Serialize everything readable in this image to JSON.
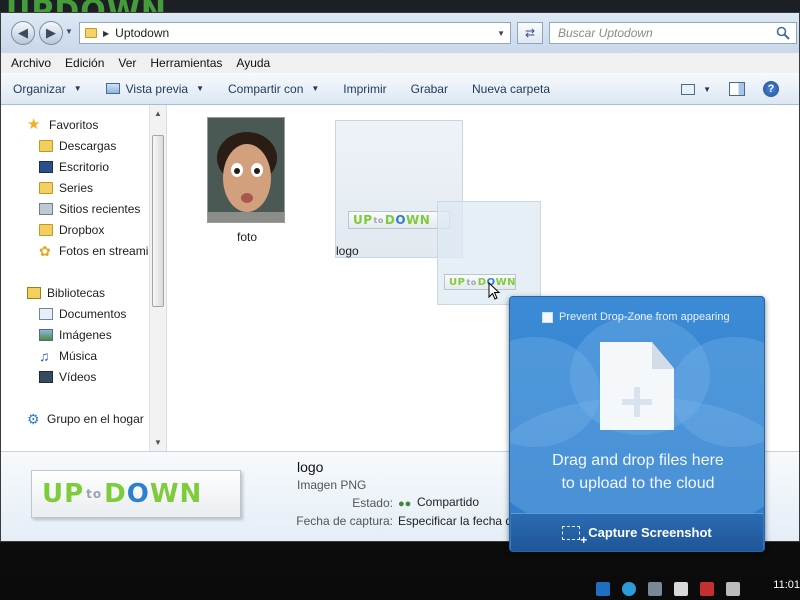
{
  "window": {
    "address": {
      "path_label": "Uptodown"
    },
    "search": {
      "placeholder": "Buscar Uptodown"
    }
  },
  "menu": [
    "Archivo",
    "Edición",
    "Ver",
    "Herramientas",
    "Ayuda"
  ],
  "commands": {
    "organizar": "Organizar",
    "vista_previa": "Vista previa",
    "compartir": "Compartir con",
    "imprimir": "Imprimir",
    "grabar": "Grabar",
    "nueva_carpeta": "Nueva carpeta"
  },
  "sidebar": {
    "items": [
      {
        "label": "Favoritos",
        "icon": "star-icon"
      },
      {
        "label": "Descargas",
        "icon": "folder-icon"
      },
      {
        "label": "Escritorio",
        "icon": "desktop-icon"
      },
      {
        "label": "Series",
        "icon": "folder-icon"
      },
      {
        "label": "Sitios recientes",
        "icon": "recent-places-icon"
      },
      {
        "label": "Dropbox",
        "icon": "folder-icon"
      },
      {
        "label": "Fotos en streamin",
        "icon": "photostream-icon"
      },
      {
        "label": "Bibliotecas",
        "icon": "libraries-icon"
      },
      {
        "label": "Documentos",
        "icon": "documents-icon"
      },
      {
        "label": "Imágenes",
        "icon": "pictures-icon"
      },
      {
        "label": "Música",
        "icon": "music-icon"
      },
      {
        "label": "Vídeos",
        "icon": "videos-icon"
      },
      {
        "label": "Grupo en el hogar",
        "icon": "homegroup-icon"
      }
    ]
  },
  "files": [
    {
      "name": "foto",
      "kind": "image"
    },
    {
      "name": "logo",
      "kind": "image"
    }
  ],
  "logo_text": {
    "up": "UP",
    "to": "to",
    "down": "DOWN",
    "o": "O"
  },
  "details": {
    "name": "logo",
    "type": "Imagen PNG",
    "estado_key": "Estado:",
    "estado_val": "Compartido",
    "fecha_key": "Fecha de captura:",
    "fecha_val": "Especificar la fecha de"
  },
  "dropzone": {
    "checkbox_label": "Prevent Drop-Zone from appearing",
    "message_line1": "Drag and drop files here",
    "message_line2": "to upload to the cloud",
    "capture_label": "Capture Screenshot"
  },
  "taskbar": {
    "clock": "11:01"
  },
  "colors": {
    "dropzone_blue": "#2f7bc8",
    "logo_green": "#7ecb3b",
    "logo_blue": "#2e7fd1"
  }
}
